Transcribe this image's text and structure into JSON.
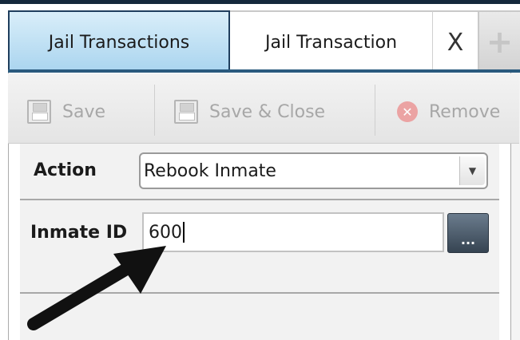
{
  "tabs": {
    "list_tab": "Jail Transactions",
    "active_tab": "Jail Transaction",
    "close_glyph": "X",
    "add_glyph": "+"
  },
  "toolbar": {
    "save_label": "Save",
    "save_close_label": "Save & Close",
    "remove_label": "Remove"
  },
  "form": {
    "action_label": "Action",
    "action_value": "Rebook Inmate",
    "inmate_id_label": "Inmate ID",
    "inmate_id_value": "600",
    "lookup_button": "..."
  },
  "colors": {
    "tab_border": "#1f3e5d",
    "tab_rule": "#2a5a7e",
    "lookup_button": "#4a5867"
  }
}
